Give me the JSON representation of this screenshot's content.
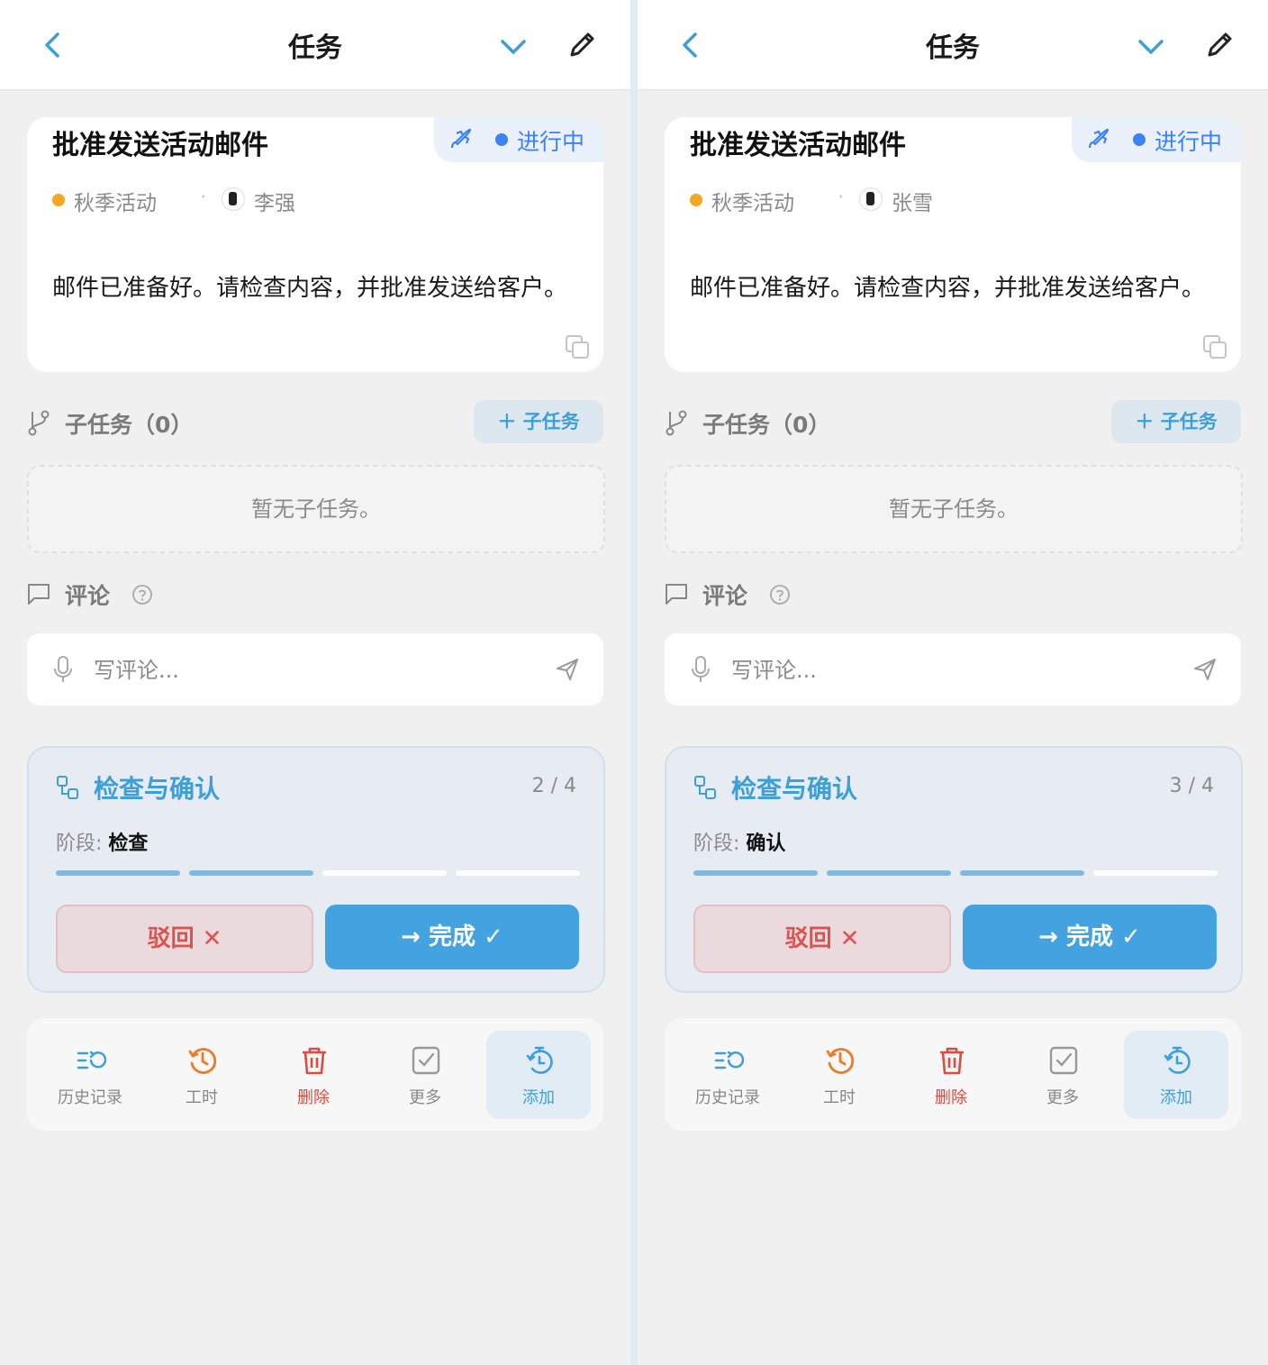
{
  "panels": [
    {
      "header": {
        "title": "任务"
      },
      "task": {
        "title": "批准发送活动邮件",
        "status": "进行中",
        "project": "秋季活动",
        "assignee": "李强",
        "description": "邮件已准备好。请检查内容，并批准发送给客户。"
      },
      "subtasks": {
        "label": "子任务（0）",
        "add_label": "＋  子任务",
        "empty": "暂无子任务。"
      },
      "comments": {
        "label": "评论",
        "placeholder": "写评论..."
      },
      "workflow": {
        "title": "检查与确认",
        "count": "2 / 4",
        "progress": 0.5,
        "stage_label": "阶段:",
        "stage_value": "检查",
        "reject_label": "驳回 ✕",
        "done_label": "→  完成 ✓"
      },
      "toolbar": [
        "历史记录",
        "工时",
        "删除",
        "更多",
        "添加"
      ]
    },
    {
      "header": {
        "title": "任务"
      },
      "task": {
        "title": "批准发送活动邮件",
        "status": "进行中",
        "project": "秋季活动",
        "assignee": "张雪",
        "description": "邮件已准备好。请检查内容，并批准发送给客户。"
      },
      "subtasks": {
        "label": "子任务（0）",
        "add_label": "＋  子任务",
        "empty": "暂无子任务。"
      },
      "comments": {
        "label": "评论",
        "placeholder": "写评论..."
      },
      "workflow": {
        "title": "检查与确认",
        "count": "3 / 4",
        "progress": 0.75,
        "stage_label": "阶段:",
        "stage_value": "确认",
        "reject_label": "驳回 ✕",
        "done_label": "→  完成 ✓"
      },
      "toolbar": [
        "历史记录",
        "工时",
        "删除",
        "更多",
        "添加"
      ]
    }
  ],
  "colors": {
    "accent": "#3d9fd9",
    "status": "#3b82f6",
    "project_dot": "#f5a623",
    "danger": "#d9534f",
    "clock": "#f07a22"
  },
  "icons": [
    "back-arrow-icon",
    "chevron-down-icon",
    "pencil-icon",
    "rocket-icon",
    "copy-icon",
    "branch-icon",
    "comment-bubble-icon",
    "help-circle-icon",
    "microphone-icon",
    "send-icon",
    "workflow-icon",
    "history-icon",
    "clock-icon",
    "trash-icon",
    "checkbox-icon",
    "timer-add-icon"
  ]
}
